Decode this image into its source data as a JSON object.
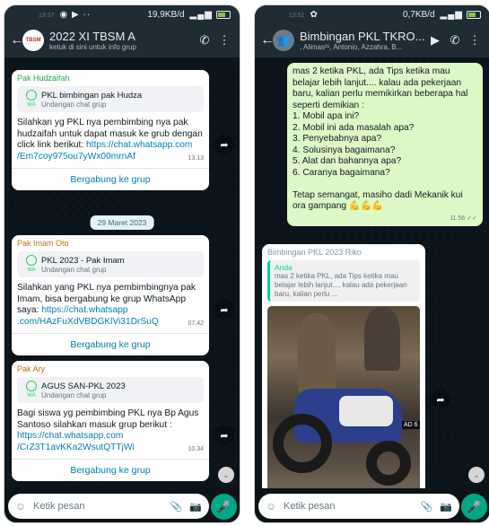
{
  "left": {
    "status": {
      "time": "19:37",
      "network": "19,9KB/d"
    },
    "header": {
      "title": "2022 XI TBSM A",
      "subtitle": "ketuk di sini untuk info grup"
    },
    "messages": [
      {
        "sender": "Pak Hudzaifah",
        "invite_title": "PKL bimbingan pak Hudza",
        "invite_sub": "Undangan chat grup",
        "text": "Silahkan yg PKL nya pembimbing nya pak hudzaifah untuk dapat masuk ke grub  dengan click link berikut: ",
        "link": "https://chat.whatsapp.com /Em7coy975ou7yWx00mrnAf",
        "time": "13.13",
        "join": "Bergabung ke grup"
      },
      {
        "sender": "Pak Imam Oto",
        "invite_title": "PKL 2023 - Pak Imam",
        "invite_sub": "Undangan chat grup",
        "text": "Silahkan yang PKL nya pembimbingnya pak Imam, bisa bergabung ke grup WhatsApp saya: ",
        "link": "https://chat.whatsapp .com/HAzFuXdVBDGKlVi31DrSuQ",
        "time": "07.42",
        "join": "Bergabung ke grup"
      },
      {
        "sender": "Pak Ary",
        "invite_title": "AGUS SAN-PKL 2023",
        "invite_sub": "Undangan chat grup",
        "text": "Bagi siswa yg pembimbing PKL nya Bp Agus Santoso silahkan masuk grup berikut :\n",
        "link": "https://chat.whatsapp.com /CrZ3T1avKKa2WsutQTTjWi",
        "time": "10.34",
        "join": "Bergabung ke grup"
      }
    ],
    "date_chip": "29 Maret 2023",
    "input_placeholder": "Ketik pesan"
  },
  "right": {
    "status": {
      "time": "13:51",
      "network": "0,7KB/d"
    },
    "header": {
      "title": "Bimbingan PKL TKRO...",
      "subtitle": ", Alimas²¹, Antonio, Azzahra, B..."
    },
    "outgoing": {
      "text": "mas 2 ketika PKL, ada Tips ketika mau belajar lebih lanjut.... kalau ada pekerjaan baru, kalian perlu memikirkan beberapa hal seperti demikian :\n1. Mobil apa ini?\n2. Mobil ini ada masalah apa?\n3. Penyebabnya apa?\n4. Solusinya bagaimana?\n5. Alat dan bahannya apa?\n6. Caranya bagaimana?\n\nTetap semangat, masiho dadi Mekanik kui ora gampang 💪💪💪",
      "time": "11.56 ✓✓"
    },
    "forwarded": {
      "group": "Bimbingan PKL 2023 Riko",
      "quote_author": "Anda",
      "quote_text": "mas 2 ketika PKL, ada Tips ketika mau belajar lebih lanjut.... kalau ada pekerjaan baru, kalian perlu ..."
    },
    "input_placeholder": "Ketik pesan"
  }
}
